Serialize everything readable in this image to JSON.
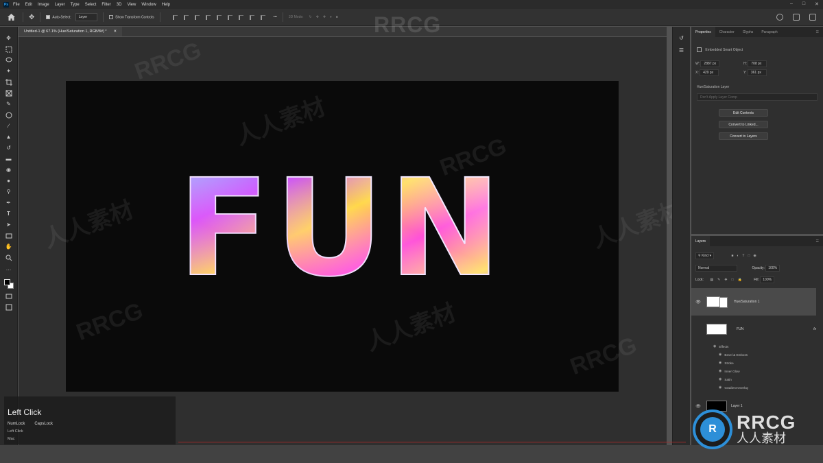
{
  "menubar": {
    "logo": "Ps",
    "items": [
      "File",
      "Edit",
      "Image",
      "Layer",
      "Type",
      "Select",
      "Filter",
      "3D",
      "View",
      "Window",
      "Help"
    ]
  },
  "options": {
    "auto_select_label": "Auto-Select:",
    "auto_select_value": "Layer",
    "transform_label": "Show Transform Controls",
    "mode_3d": "3D Mode:"
  },
  "document": {
    "tab_title": "Untitled-1 @ 67.1% (Hue/Saturation 1, RGB/8#) *",
    "text": "FUN"
  },
  "properties": {
    "tabs": [
      "Properties",
      "Character",
      "Glyphs",
      "Paragraph"
    ],
    "type_label": "Embedded Smart Object",
    "w_label": "W:",
    "w_value": "2887 px",
    "h_label": "H:",
    "h_value": "708 px",
    "x_label": "X:",
    "x_value": "429 px",
    "y_label": "Y:",
    "y_value": "361 px",
    "comp_section": "Hue/Saturation Layer",
    "comp_placeholder": "Don't Apply Layer Comp",
    "buttons": [
      "Edit Contents",
      "Convert to Linked...",
      "Convert to Layers"
    ]
  },
  "layers": {
    "title": "Layers",
    "filter_label": "Kind",
    "blend_mode": "Normal",
    "opacity_label": "Opacity:",
    "opacity_value": "100%",
    "lock_label": "Lock:",
    "fill_label": "Fill:",
    "fill_value": "100%",
    "items": [
      {
        "name": "Hue/Saturation 1"
      },
      {
        "name": "FUN"
      },
      {
        "name": "Layer 1"
      }
    ],
    "effects_label": "Effects",
    "effects": [
      "Bevel & Emboss",
      "Stroke",
      "Inner Glow",
      "Satin",
      "Gradient Overlay"
    ]
  },
  "overlay": {
    "title": "Left Click",
    "keys": [
      "NumLock",
      "CapsLock"
    ],
    "line1": "Left Click",
    "line2": "Mac"
  },
  "watermark": {
    "top": "RRCG",
    "text": "RRCG",
    "cn": "人人素材"
  },
  "logo": {
    "main": "RRCG",
    "sub": "人人素材",
    "glyph": "R"
  },
  "colors": {
    "panel_bg": "#2f2f2f",
    "canvas_bg": "#0a0a0a",
    "accent_blue": "#2d8fd8",
    "status_red": "#9e2b2b"
  }
}
